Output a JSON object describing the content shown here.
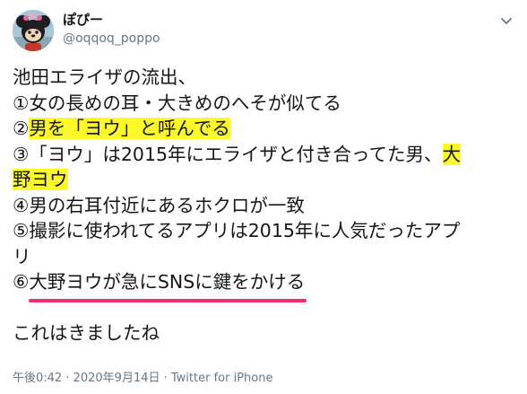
{
  "author": {
    "display_name": "ぽぴー",
    "handle": "@oqqoq_poppo"
  },
  "tweet": {
    "line1": "池田エライザの流出、",
    "line2": "①女の長めの耳・大きめのへそが似てる",
    "line3_prefix": "②",
    "line3_highlight": "男を「ヨウ」と呼んでる",
    "line4_prefix": "③「ヨウ」は2015年にエライザと付き合ってた男、",
    "line4_highlight": "大",
    "line5_highlight": "野ヨウ",
    "line6": "④男の右耳付近にあるホクロが一致",
    "line7": "⑤撮影に使われてるアプリは2015年に人気だったアプ",
    "line8": "リ",
    "line9_prefix": "⑥",
    "line9_underlined": "大野ヨウが急にSNSに鍵をかける",
    "line11": "これはきましたね"
  },
  "meta": {
    "timestamp": "午後0:42 · 2020年9月14日 · Twitter for iPhone"
  },
  "colors": {
    "highlight": "#fcf82a",
    "underline": "#f0306f",
    "secondary_text": "#657786"
  },
  "icons": {
    "avatar": "avatar",
    "menu": "chevron-down-icon"
  }
}
